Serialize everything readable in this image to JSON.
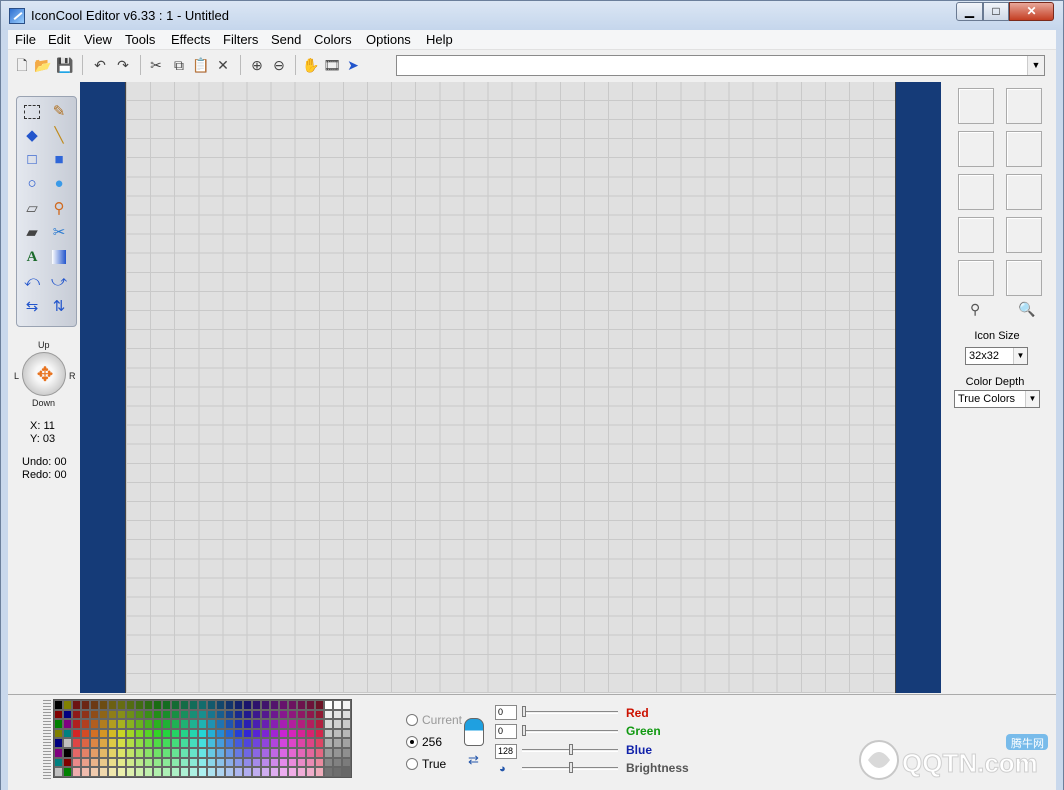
{
  "window": {
    "title": "IconCool Editor v6.33 : 1 - Untitled"
  },
  "menu": [
    "File",
    "Edit",
    "View",
    "Tools",
    "Effects",
    "Filters",
    "Send",
    "Colors",
    "Options",
    "Help"
  ],
  "toolbar": {
    "icons": [
      "new-file-icon",
      "open-folder-icon",
      "save-icon",
      "undo-icon",
      "redo-icon",
      "cut-icon",
      "copy-icon",
      "paste-icon",
      "delete-icon",
      "zoom-in-icon",
      "zoom-out-icon",
      "hand-icon",
      "film-icon",
      "pointer-icon"
    ],
    "combo_value": ""
  },
  "tools": [
    "select",
    "pencil",
    "fill",
    "line",
    "rectangle",
    "filled-rectangle",
    "ellipse",
    "filled-ellipse",
    "eraser",
    "color-picker",
    "smudge",
    "scissors",
    "text",
    "gradient",
    "rotate-left",
    "rotate-right",
    "flip-horizontal",
    "flip-vertical"
  ],
  "nav": {
    "up": "Up",
    "down": "Down",
    "left": "L",
    "right": "R"
  },
  "status": {
    "x": "X: 11",
    "y": "Y: 03",
    "undo": "Undo: 00",
    "redo": "Redo: 00"
  },
  "right_panel": {
    "icon_size_label": "Icon Size",
    "icon_size_value": "32x32",
    "color_depth_label": "Color Depth",
    "color_depth_value": "True Colors"
  },
  "color_mode": {
    "options": [
      "Current",
      "256",
      "True"
    ],
    "selected": "256"
  },
  "sliders": {
    "red_value": "0",
    "red_label": "Red",
    "green_value": "0",
    "green_label": "Green",
    "blue_value": "128",
    "blue_label": "Blue",
    "brightness_label": "Brightness"
  },
  "colors": {
    "red": "#cc1100",
    "green": "#119911",
    "blue": "#1122aa",
    "canvas_bg": "#153b78"
  },
  "watermark": {
    "text": "QQTN.com",
    "cn": "腾牛网"
  }
}
